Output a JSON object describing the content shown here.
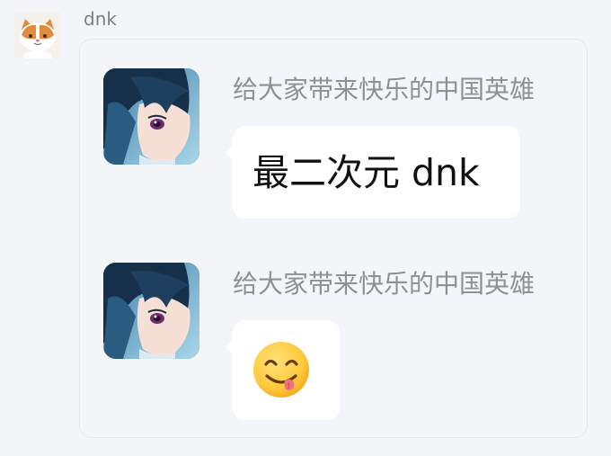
{
  "sender": {
    "name": "dnk",
    "avatar_icon": "cat-avatar"
  },
  "forwarded": {
    "messages": [
      {
        "name": "给大家带来快乐的中国英雄",
        "avatar_icon": "anime-boy-avatar",
        "text": "最二次元 dnk"
      },
      {
        "name": "给大家带来快乐的中国英雄",
        "avatar_icon": "anime-boy-avatar",
        "emoji": "yum-face-emoji"
      }
    ]
  },
  "colors": {
    "background": "#f4f5f9",
    "bubble": "#ffffff",
    "name_text": "#8d9098",
    "message_text": "#111111"
  }
}
